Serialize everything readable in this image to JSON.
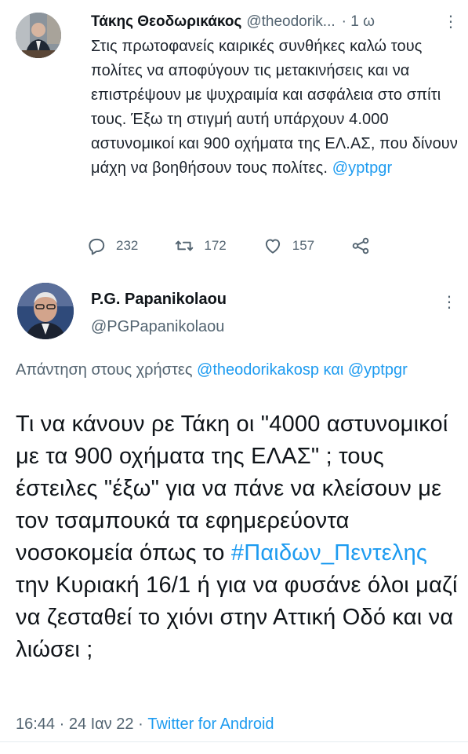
{
  "tweet1": {
    "name": "Τάκης Θεοδωρικάκος",
    "handle": "@theodorik...",
    "time": "· 1 ω",
    "text_before_link": "Στις πρωτοφανείς καιρικές συνθήκες καλώ τους πολίτες να αποφύγουν τις μετακινήσεις και να επιστρέψουν με ψυχραιμία και ασφάλεια στο σπίτι τους. Έξω τη στιγμή αυτή υπάρχουν 4.000 αστυνομικοί και 900 οχήματα της ΕΛ.ΑΣ, που δίνουν μάχη να βοηθήσουν τους πολίτες. ",
    "mention": "@yptpgr",
    "replies": "232",
    "retweets": "172",
    "likes": "157"
  },
  "tweet2": {
    "name": "P.G. Papanikolaou",
    "handle": "@PGPapanikolaou",
    "reply_prefix": "Απάντηση στους χρήστες ",
    "reply_mention1": "@theodorikakosp",
    "reply_and": " και ",
    "reply_mention2": "@yptpgr",
    "text_part1": "Τι να κάνουν ρε Τάκη οι \"4000 αστυνομικοί με τα 900 οχήματα της ΕΛΑΣ\" ; τους έστειλες \"έξω\" για να πάνε να κλείσουν με τον τσαμπουκά τα εφημερεύοντα νοσοκομεία όπως το ",
    "hashtag": "#Παιδων_Πεντελης",
    "text_part2": " την Κυριακή 16/1 ή για να φυσάνε όλοι μαζί να ζεσταθεί το χιόνι στην Αττική Οδό και να λιώσει ;",
    "timestamp": "16:44 · 24 Ιαν 22 · ",
    "source": "Twitter for Android"
  },
  "icons": {
    "reply": "reply-icon",
    "retweet": "retweet-icon",
    "like": "heart-icon",
    "share": "share-icon",
    "more": "more-vertical-icon"
  },
  "colors": {
    "link": "#1d9bf0",
    "secondary_text": "#536471",
    "primary_text": "#0f1419"
  }
}
